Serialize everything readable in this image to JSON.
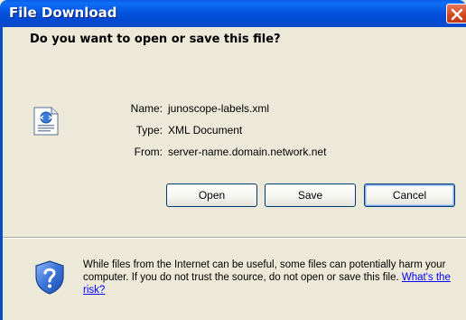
{
  "window": {
    "title": "File Download"
  },
  "dialog": {
    "question": "Do you want to open or save this file?",
    "file_info": {
      "name_label": "Name:",
      "name_value": "junoscope-labels.xml",
      "type_label": "Type:",
      "type_value": "XML Document",
      "from_label": "From:",
      "from_value": "server-name.domain.network.net"
    },
    "buttons": {
      "open": "Open",
      "save": "Save",
      "cancel": "Cancel"
    },
    "warning_text": "While files from the Internet can be useful, some files can potentially harm your computer. If you do not trust the source, do not open or save this file.",
    "risk_link": "What's the risk?"
  },
  "icons": {
    "file": "xml-document-icon",
    "close": "close-icon",
    "shield": "shield-question-icon"
  },
  "colors": {
    "titlebar": "#0454E0",
    "close_button": "#D4451E",
    "dialog_background": "#ECE9D8",
    "link": "#0000FF"
  }
}
